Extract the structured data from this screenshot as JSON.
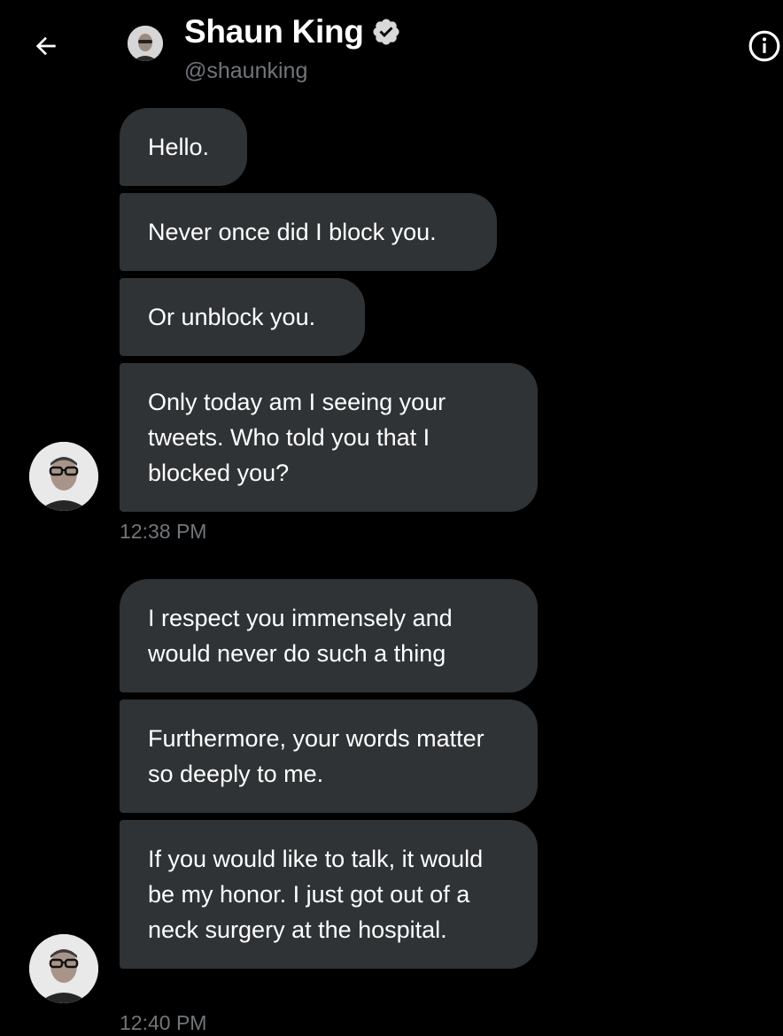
{
  "header": {
    "name": "Shaun King",
    "handle": "@shaunking",
    "back_icon": "arrow-left-icon",
    "verified_icon": "verified-badge-icon",
    "info_icon": "info-icon"
  },
  "messages": [
    {
      "text": "Hello."
    },
    {
      "text": "Never once did I block you."
    },
    {
      "text": "Or unblock you."
    },
    {
      "text": "Only today am I seeing your tweets. Who told you that I blocked you?"
    },
    {
      "text": "I respect you immensely and would never do such a thing"
    },
    {
      "text": "Furthermore, your words matter so deeply to me."
    },
    {
      "text": "If you would like to talk, it would be my honor. I just got out of a neck surgery at the hospital."
    }
  ],
  "timestamps": [
    "12:38 PM",
    "12:40 PM"
  ],
  "colors": {
    "background": "#000000",
    "bubble": "#2f3336",
    "secondary_text": "#71767b"
  }
}
